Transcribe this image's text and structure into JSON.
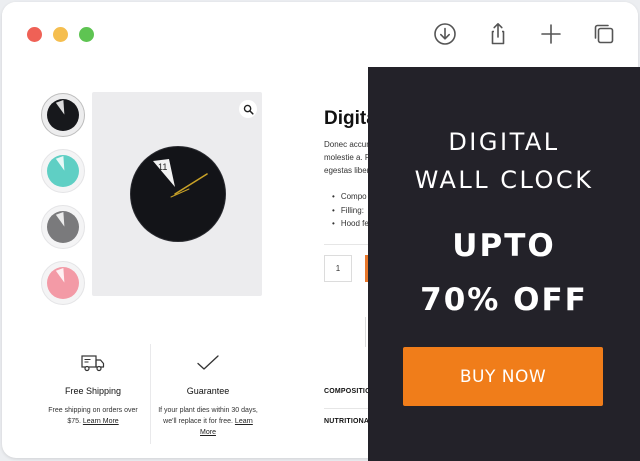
{
  "browser": {
    "toolbar_icons": [
      "download-icon",
      "share-icon",
      "plus-icon",
      "tabs-icon"
    ]
  },
  "product": {
    "title": "Digita",
    "description_lines": [
      "Donec accum",
      "molestie a. P",
      "egestas liber"
    ],
    "bullets": [
      "Compo",
      "Filling:",
      "Hood fe"
    ],
    "quantity": "1",
    "clock_number": "11",
    "swatches": [
      {
        "name": "black",
        "color": "#17181c"
      },
      {
        "name": "teal",
        "color": "#5fcfc4"
      },
      {
        "name": "gray",
        "color": "#7a7a7c"
      },
      {
        "name": "pink",
        "color": "#f39aa6"
      }
    ],
    "sections": [
      "COMPOSITIO",
      "NUTRITIONAL"
    ]
  },
  "features": [
    {
      "icon": "delivery-truck-icon",
      "title": "Free Shipping",
      "description": "Free shipping on orders over $75.",
      "link": "Learn More"
    },
    {
      "icon": "checkmark-icon",
      "title": "Guarantee",
      "description": "If your plant dies within 30 days, we'll replace it for free.",
      "link": "Learn More"
    }
  ],
  "promo": {
    "line1": "DIGITAL",
    "line2": "WALL CLOCK",
    "offer_line1": "UPTO",
    "offer_line2": "70% OFF",
    "button_label": "BUY NOW",
    "accent_color": "#f07d1a",
    "panel_color": "#232229"
  }
}
